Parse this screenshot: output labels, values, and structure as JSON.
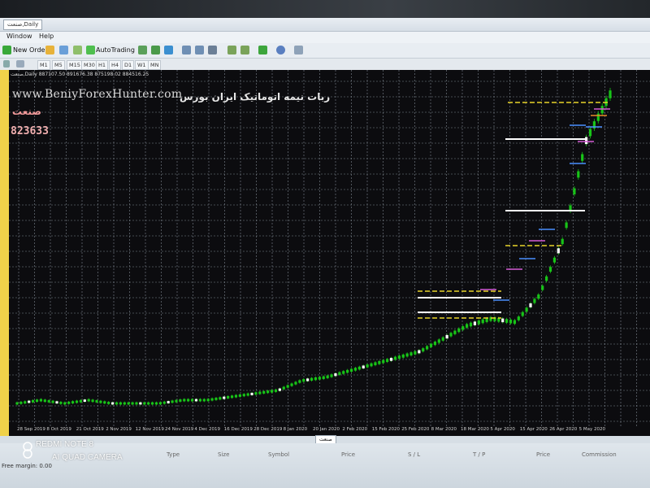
{
  "window": {
    "title_tab": "صنعت,Daily"
  },
  "menu": {
    "items": [
      "Window",
      "Help"
    ]
  },
  "toolbar": {
    "new_order": "New Order",
    "auto_trading": "AutoTrading"
  },
  "timeframes": [
    "M1",
    "M5",
    "M15",
    "M30",
    "H1",
    "H4",
    "D1",
    "W1",
    "MN"
  ],
  "chart": {
    "header": "صنعت,Daily  887107.50 891676.38 875198.02 884516.25",
    "watermark": "www.BeniyForexHunter.com",
    "persian_caption": "ربات نیمه اتوماتیک ایران بورس",
    "symbol_label": "صنعت",
    "price_label": "823633"
  },
  "chart_data": {
    "type": "line",
    "title": "",
    "xlabel": "",
    "ylabel": "",
    "x_tick_labels": [
      "28 Sep 2019",
      "8 Oct 2019",
      "21 Oct 2019",
      "2 Nov 2019",
      "12 Nov 2019",
      "24 Nov 2019",
      "4 Dec 2019",
      "16 Dec 2019",
      "28 Dec 2019",
      "8 Jan 2020",
      "20 Jan 2020",
      "2 Feb 2020",
      "15 Feb 2020",
      "25 Feb 2020",
      "8 Mar 2020",
      "18 Mar 2020",
      "5 Apr 2020",
      "15 Apr 2020",
      "26 Apr 2020",
      "5 May 2020"
    ],
    "series": [
      {
        "values": [
          0.05,
          0.06,
          0.05,
          0.06,
          0.05,
          0.05,
          0.05,
          0.06,
          0.06,
          0.07,
          0.08,
          0.09,
          0.12,
          0.13,
          0.15,
          0.17,
          0.19,
          0.21,
          0.25,
          0.29,
          0.31,
          0.3,
          0.38,
          0.55,
          0.86,
          1.0
        ],
        "color": "#18c418"
      }
    ],
    "grid": true
  },
  "bottom": {
    "tab": "صنعت",
    "columns": [
      "Type",
      "Size",
      "Symbol",
      "Price",
      "S / L",
      "T / P",
      "Price",
      "Commission"
    ],
    "free_margin": "Free margin: 0.00"
  },
  "photo_stamp": {
    "line1": "REDMI NOTE 8",
    "line2": "AI QUAD CAMERA"
  },
  "colors": {
    "chart_bg": "#0c0c0f",
    "candle": "#18c418",
    "grid": "#7f8790",
    "level_white": "#ffffff",
    "level_yellow": "#e8d42a"
  }
}
